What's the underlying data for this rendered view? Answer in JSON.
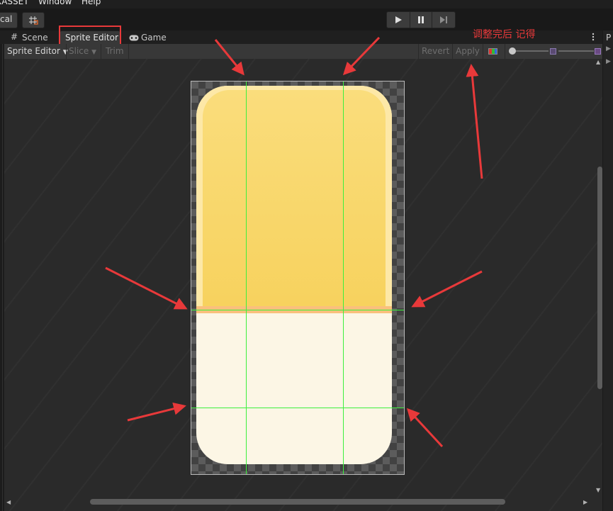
{
  "menubar": {
    "items": [
      "XASSET",
      "Window",
      "Help"
    ]
  },
  "toolbar": {
    "left_button": "cal"
  },
  "tabs": [
    {
      "label": "Scene",
      "icon": "grid-icon"
    },
    {
      "label": "Sprite Editor",
      "active": true
    },
    {
      "label": "Game",
      "icon": "gamepad-icon"
    }
  ],
  "sprite_toolbar": {
    "mode_label": "Sprite Editor",
    "slice_label": "Slice",
    "trim_label": "Trim",
    "revert_label": "Revert",
    "apply_label": "Apply"
  },
  "annotation": {
    "text": "调整完后 记得",
    "color": "#e8393a"
  },
  "colors": {
    "slice_guide": "#3cf03c",
    "highlight": "#e8393a",
    "sprite_top": "#f7d25e",
    "sprite_bottom": "#fcf6e5",
    "sprite_band": "#f9c07c"
  },
  "right_panel": {
    "label": "P"
  }
}
